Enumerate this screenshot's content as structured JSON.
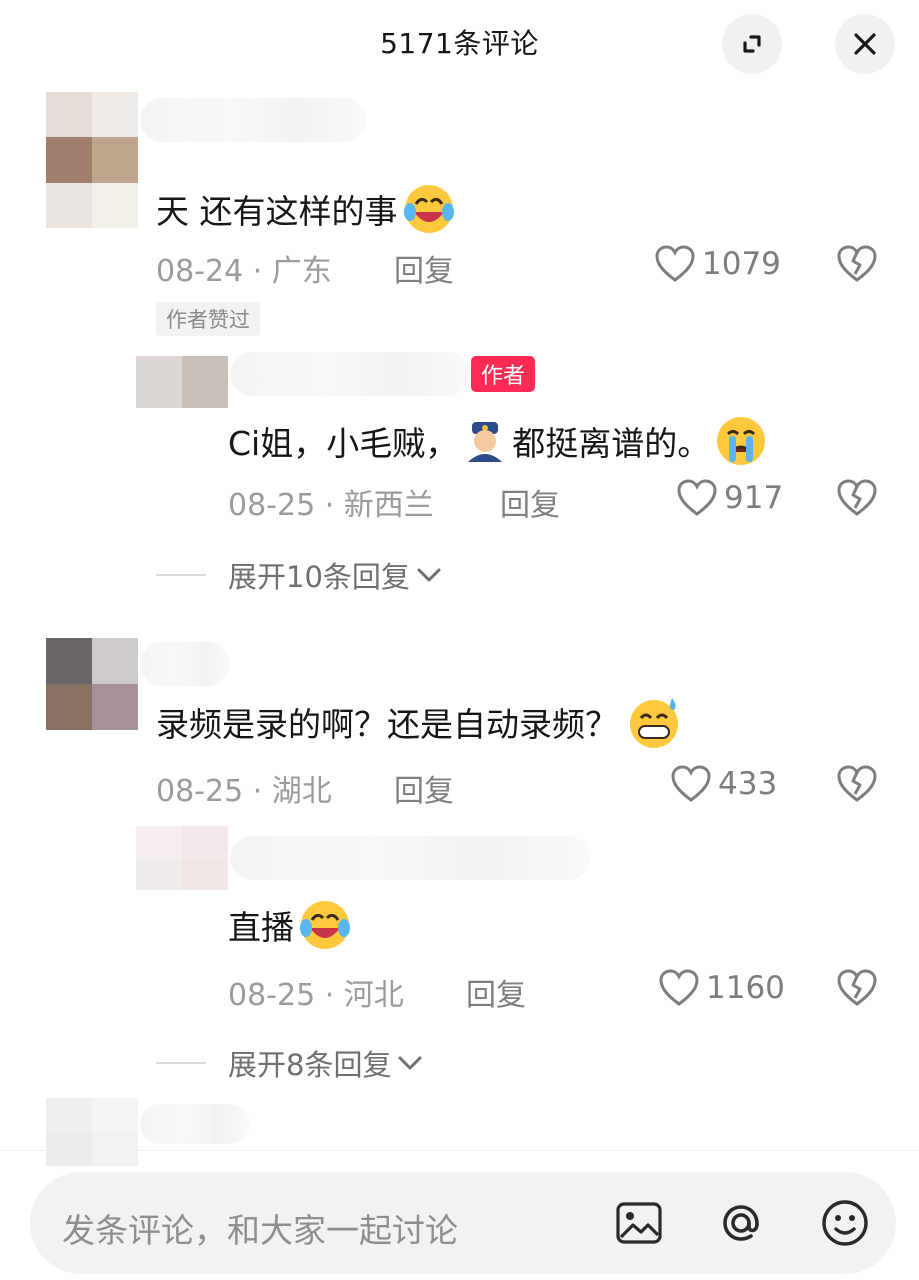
{
  "header": {
    "title": "5171条评论"
  },
  "comments": [
    {
      "text": "天 还有这样的事",
      "date_location": "08-24 · 广东",
      "reply_label": "回复",
      "likes": "1079",
      "tag": "作者赞过",
      "reply": {
        "badge": "作者",
        "text": "Ci姐，小毛贼，",
        "text_after_emoji": "都挺离谱的。",
        "date_location": "08-25 · 新西兰",
        "reply_label": "回复",
        "likes": "917"
      },
      "expand_label": "展开10条回复"
    },
    {
      "text": "录频是录的啊？还是自动录频？",
      "date_location": "08-25 · 湖北",
      "reply_label": "回复",
      "likes": "433",
      "reply": {
        "text": "直播",
        "date_location": "08-25 · 河北",
        "reply_label": "回复",
        "likes": "1160"
      },
      "expand_label": "展开8条回复"
    }
  ],
  "input": {
    "placeholder": "发条评论，和大家一起讨论"
  },
  "colors": {
    "author_badge": "#fe2c55",
    "meta_text": "#9b9b9b",
    "input_bg": "#f2f2f3"
  },
  "icons": [
    "expand-icon",
    "close-icon",
    "heart-icon",
    "broken-heart-icon",
    "chevron-down-icon",
    "image-icon",
    "at-icon",
    "smiley-icon"
  ]
}
